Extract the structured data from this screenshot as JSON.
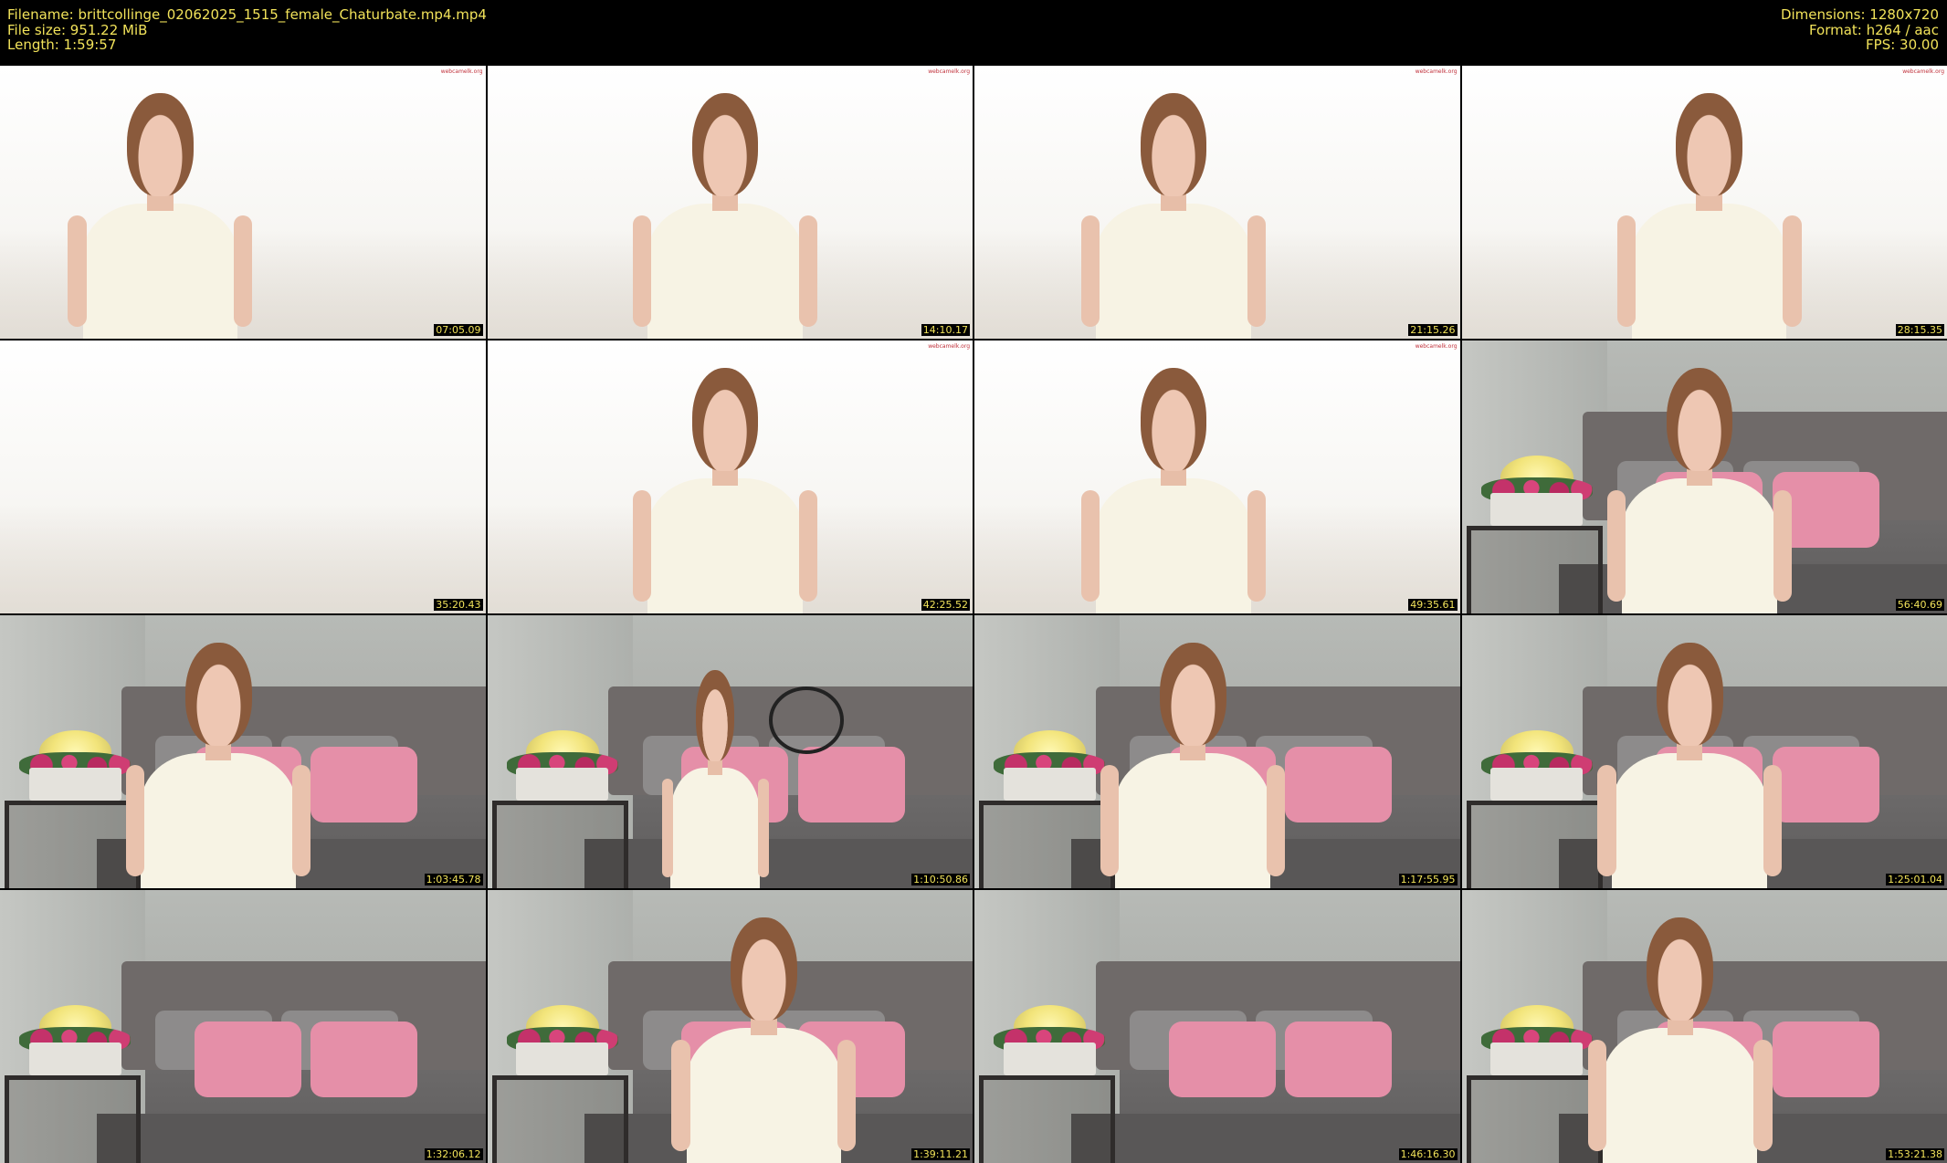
{
  "header": {
    "filename": "Filename: brittcollinge_02062025_1515_female_Chaturbate.mp4.mp4",
    "filesize": "File size: 951.22 MiB",
    "length": "Length: 1:59:57",
    "dimensions": "Dimensions: 1280x720",
    "format": "Format: h264 / aac",
    "fps": "FPS: 30.00"
  },
  "colors": {
    "text": "#f2e35a",
    "background": "#000000"
  },
  "thumbnails": [
    {
      "timestamp": "07:05.09",
      "scene": "bright",
      "watermark": "webcamelk.org"
    },
    {
      "timestamp": "14:10.17",
      "scene": "bright",
      "watermark": "webcamelk.org"
    },
    {
      "timestamp": "21:15.26",
      "scene": "bright",
      "watermark": "webcamelk.org"
    },
    {
      "timestamp": "28:15.35",
      "scene": "bright",
      "watermark": "webcamelk.org"
    },
    {
      "timestamp": "35:20.43",
      "scene": "bright-empty",
      "watermark": ""
    },
    {
      "timestamp": "42:25.52",
      "scene": "bright",
      "watermark": "webcamelk.org"
    },
    {
      "timestamp": "49:35.61",
      "scene": "bright",
      "watermark": "webcamelk.org"
    },
    {
      "timestamp": "56:40.69",
      "scene": "room",
      "watermark": ""
    },
    {
      "timestamp": "1:03:45.78",
      "scene": "room",
      "watermark": ""
    },
    {
      "timestamp": "1:10:50.86",
      "scene": "room-wide",
      "watermark": ""
    },
    {
      "timestamp": "1:17:55.95",
      "scene": "room",
      "watermark": ""
    },
    {
      "timestamp": "1:25:01.04",
      "scene": "room",
      "watermark": ""
    },
    {
      "timestamp": "1:32:06.12",
      "scene": "room-empty",
      "watermark": ""
    },
    {
      "timestamp": "1:39:11.21",
      "scene": "room",
      "watermark": ""
    },
    {
      "timestamp": "1:46:16.30",
      "scene": "room-empty",
      "watermark": ""
    },
    {
      "timestamp": "1:53:21.38",
      "scene": "room",
      "watermark": ""
    }
  ]
}
